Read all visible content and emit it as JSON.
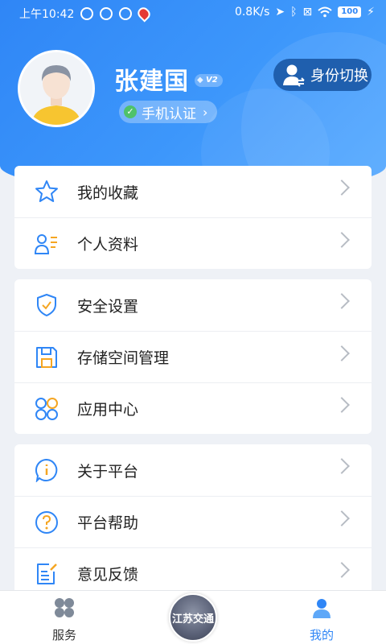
{
  "status_bar": {
    "time": "上午10:42",
    "network_speed": "0.8K/s",
    "battery": "100"
  },
  "profile": {
    "name": "张建国",
    "vip_level": "V2",
    "verify_label": "手机认证",
    "switch_label": "身份切换"
  },
  "menu_groups": [
    [
      {
        "label": "我的收藏",
        "icon": "star-icon"
      },
      {
        "label": "个人资料",
        "icon": "profile-list-icon"
      }
    ],
    [
      {
        "label": "安全设置",
        "icon": "shield-icon"
      },
      {
        "label": "存储空间管理",
        "icon": "floppy-icon"
      },
      {
        "label": "应用中心",
        "icon": "apps-icon"
      }
    ],
    [
      {
        "label": "关于平台",
        "icon": "info-icon"
      },
      {
        "label": "平台帮助",
        "icon": "help-icon"
      },
      {
        "label": "意见反馈",
        "icon": "feedback-icon"
      }
    ]
  ],
  "tabbar": {
    "service": "服务",
    "center_logo": "江苏交通",
    "mine": "我的"
  },
  "colors": {
    "header_blue": "#3b94fa",
    "icon_blue": "#2f86f6",
    "icon_orange": "#f5a623",
    "verify_green": "#4fc26a",
    "active_tab": "#2f86f6"
  }
}
